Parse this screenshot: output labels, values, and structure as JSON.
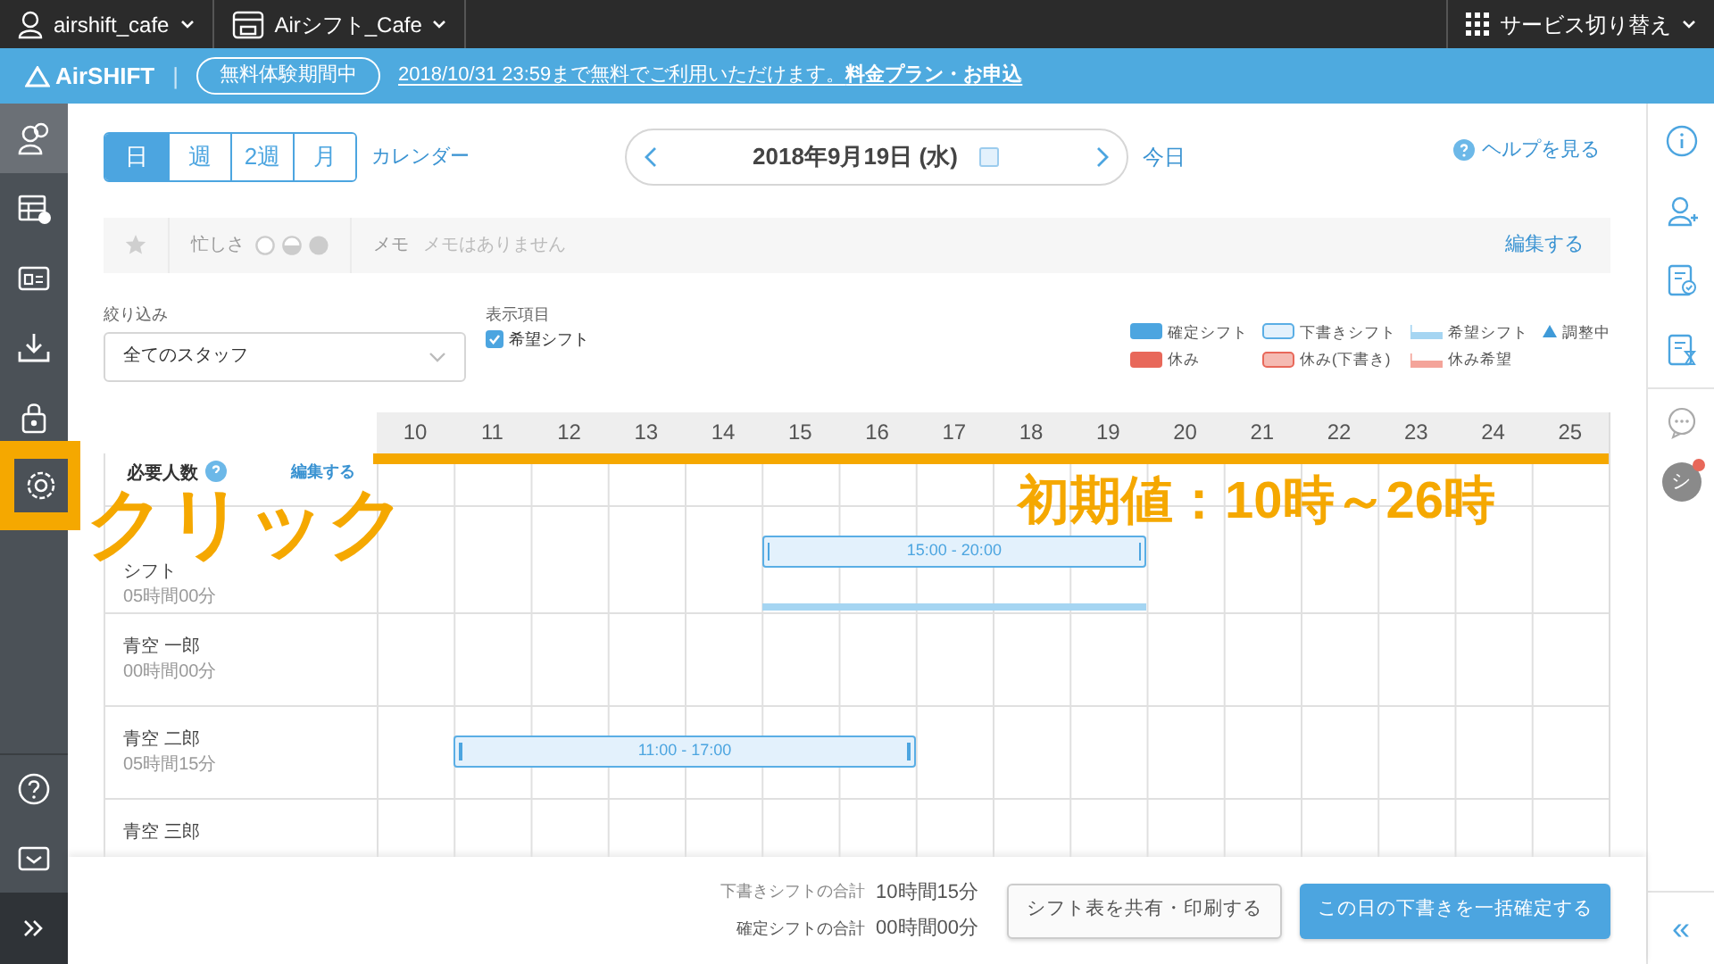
{
  "top_bar": {
    "account": "airshift_cafe",
    "store": "Airシフト_Cafe",
    "service_switch": "サービス切り替え"
  },
  "banner": {
    "logo": "AirSHIFT",
    "separator": "|",
    "trial_badge": "無料体験期間中",
    "message": "2018/10/31 23:59まで無料でご利用いただけます。",
    "link": "料金プラン・お申込"
  },
  "sidebar": {
    "items": [
      {
        "selected": true,
        "highlighted": false
      },
      {
        "selected": false,
        "highlighted": false
      },
      {
        "selected": false,
        "highlighted": false
      },
      {
        "selected": false,
        "highlighted": false
      },
      {
        "selected": false,
        "highlighted": false
      },
      {
        "selected": false,
        "highlighted": true
      },
      {
        "selected": false,
        "highlighted": false
      },
      {
        "selected": false,
        "highlighted": false
      },
      {
        "selected": false,
        "highlighted": false
      }
    ]
  },
  "view_tabs": [
    {
      "label": "日",
      "selected": true
    },
    {
      "label": "週",
      "selected": false
    },
    {
      "label": "2週",
      "selected": false
    },
    {
      "label": "月",
      "selected": false
    }
  ],
  "calendar_link": "カレンダー",
  "date_nav": {
    "date": "2018年9月19日 (水)",
    "today": "今日"
  },
  "help": "ヘルプを見る",
  "memo_bar": {
    "busyness_label": "忙しさ",
    "memo_label": "メモ",
    "memo_text": "メモはありません",
    "edit": "編集する"
  },
  "filter": {
    "label": "絞り込み",
    "value": "全てのスタッフ"
  },
  "display_items": {
    "label": "表示項目",
    "options": [
      {
        "label": "希望シフト",
        "checked": true
      }
    ]
  },
  "legend": [
    {
      "label": "確定シフト",
      "kind": "fill",
      "color": "#4ca5e0"
    },
    {
      "label": "下書きシフト",
      "kind": "outline",
      "color": "#e3f1fc"
    },
    {
      "label": "希望シフト",
      "kind": "line",
      "color": "#a5d5f2"
    },
    {
      "label": "調整中",
      "kind": "triangle",
      "color": "#3f9ad8"
    },
    {
      "label": "休み",
      "kind": "fill",
      "color": "#e8685a"
    },
    {
      "label": "休み(下書き)",
      "kind": "outline",
      "color": "#f5bab2"
    },
    {
      "label": "休み希望",
      "kind": "line",
      "color": "#f4a49a"
    }
  ],
  "grid": {
    "hours": [
      "10",
      "11",
      "12",
      "13",
      "14",
      "15",
      "16",
      "17",
      "18",
      "19",
      "20",
      "21",
      "22",
      "23",
      "24",
      "25"
    ],
    "highlight_line": true,
    "required_row": {
      "label": "必要人数",
      "edit": "編集する"
    },
    "rows": [
      {
        "name": "シフト",
        "hours": "05時間00分",
        "shifts": [
          {
            "kind": "draft",
            "label": "15:00 - 20:00",
            "wish_line": true
          }
        ]
      },
      {
        "name": "青空 一郎",
        "hours": "00時間00分",
        "shifts": []
      },
      {
        "name": "青空 二郎",
        "hours": "05時間15分",
        "shifts": [
          {
            "kind": "draft",
            "label": "11:00 - 17:00",
            "wish_line": false
          }
        ]
      },
      {
        "name": "青空 三郎"
      }
    ]
  },
  "footer": {
    "totals": [
      {
        "label": "下書きシフトの合計",
        "value": "10時間15分"
      },
      {
        "label": "確定シフトの合計",
        "value": "00時間00分"
      }
    ],
    "buttons": [
      {
        "label": "シフト表を共有・印刷する",
        "kind": "secondary"
      },
      {
        "label": "この日の下書きを一括確定する",
        "kind": "primary"
      }
    ]
  },
  "right_sidebar": {
    "avatar": "シ",
    "notification": true,
    "collapse": "«"
  },
  "annotations": [
    {
      "kind": "click",
      "text": "クリック"
    },
    {
      "kind": "range",
      "text": "初期値：10時～26時"
    }
  ]
}
